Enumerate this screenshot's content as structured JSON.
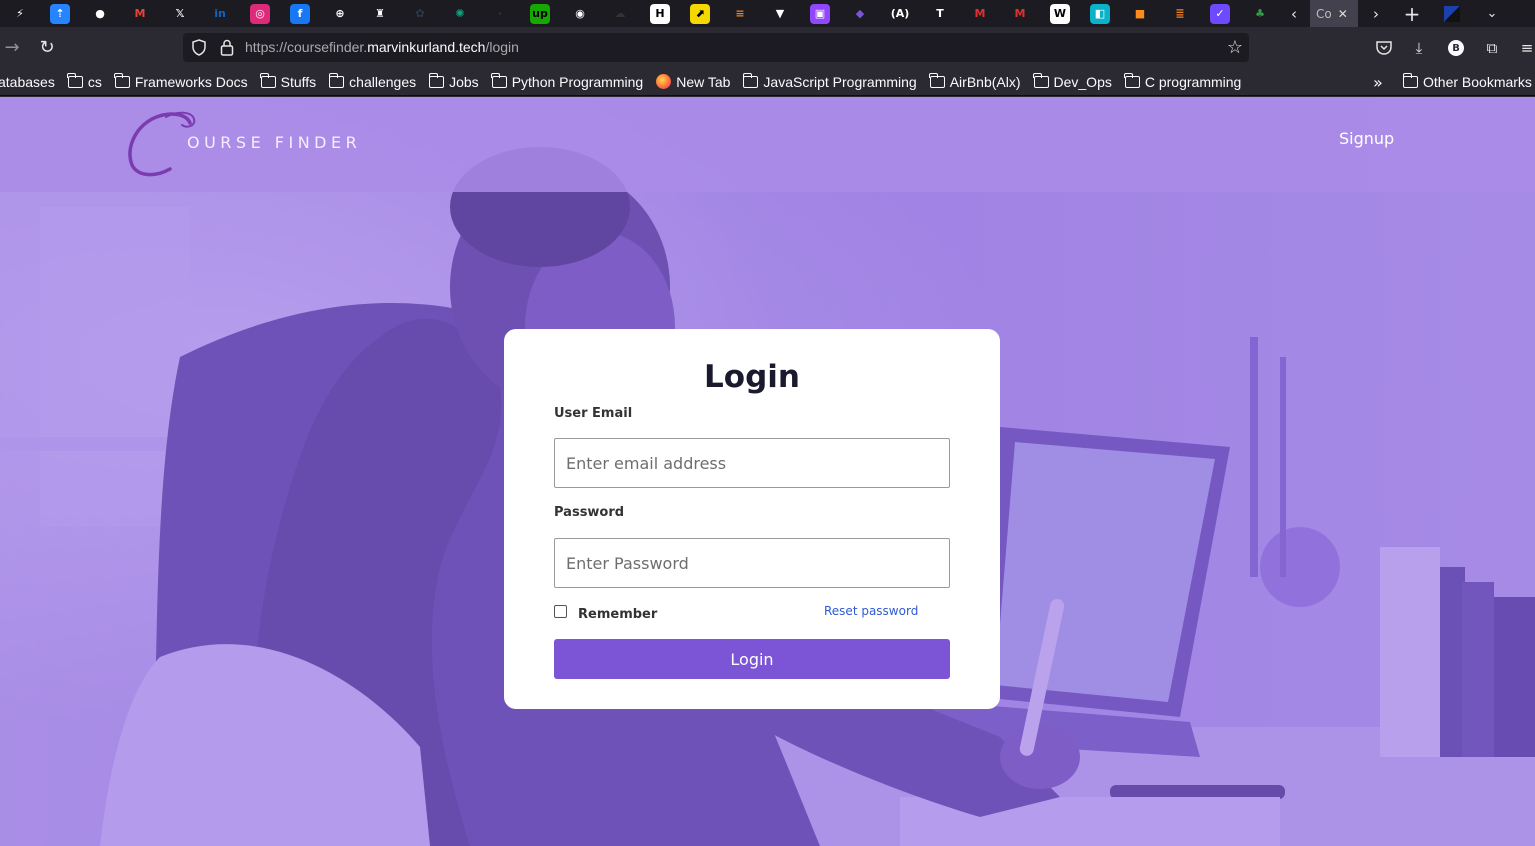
{
  "browser": {
    "tabs": [
      {
        "icon": "zed-icon",
        "glyph": "⚡",
        "color": "#ffffff",
        "bg": "#1c1b22"
      },
      {
        "icon": "jira-icon",
        "glyph": "⇡",
        "color": "#ffffff",
        "bg": "#2684ff"
      },
      {
        "icon": "reddit-icon",
        "glyph": "●",
        "color": "#ffffff",
        "bg": "#1c1b22"
      },
      {
        "icon": "gmail-icon",
        "glyph": "M",
        "color": "#ea4335",
        "bg": "#1c1b22"
      },
      {
        "icon": "x-icon",
        "glyph": "𝕏",
        "color": "#ffffff",
        "bg": "#1c1b22"
      },
      {
        "icon": "linkedin-icon",
        "glyph": "in",
        "color": "#0a66c2",
        "bg": "#1c1b22"
      },
      {
        "icon": "instagram-icon",
        "glyph": "◎",
        "color": "#ffffff",
        "bg": "#dd2a7b"
      },
      {
        "icon": "facebook-icon",
        "glyph": "f",
        "color": "#ffffff",
        "bg": "#1877f2"
      },
      {
        "icon": "globe-icon",
        "glyph": "⊕",
        "color": "#ffffff",
        "bg": "#1c1b22"
      },
      {
        "icon": "puzzle-icon",
        "glyph": "♜",
        "color": "#ffffff",
        "bg": "#1c1b22"
      },
      {
        "icon": "settings-icon",
        "glyph": "✿",
        "color": "#2a3a50",
        "bg": "#1c1b22"
      },
      {
        "icon": "chatgpt-icon",
        "glyph": "✺",
        "color": "#10a37f",
        "bg": "#1c1b22"
      },
      {
        "icon": "blank-icon",
        "glyph": "·",
        "color": "#333",
        "bg": "#1c1b22"
      },
      {
        "icon": "upwork-icon",
        "glyph": "up",
        "color": "#000000",
        "bg": "#14a800"
      },
      {
        "icon": "github-icon",
        "glyph": "◉",
        "color": "#ffffff",
        "bg": "#1c1b22"
      },
      {
        "icon": "cloud-icon",
        "glyph": "☁",
        "color": "#333",
        "bg": "#1c1b22"
      },
      {
        "icon": "hackernoon-icon",
        "glyph": "H",
        "color": "#000000",
        "bg": "#ffffff"
      },
      {
        "icon": "arrow-icon",
        "glyph": "⬈",
        "color": "#000000",
        "bg": "#f5d800"
      },
      {
        "icon": "stack-icon",
        "glyph": "≡",
        "color": "#f48024",
        "bg": "#1c1b22"
      },
      {
        "icon": "mic-icon",
        "glyph": "▼",
        "color": "#ffffff",
        "bg": "#1c1b22"
      },
      {
        "icon": "twitch-icon",
        "glyph": "▣",
        "color": "#ffffff",
        "bg": "#9146ff"
      },
      {
        "icon": "teams-icon",
        "glyph": "◆",
        "color": "#7b55d6",
        "bg": "#1c1b22"
      },
      {
        "icon": "alx-icon",
        "glyph": "(A)",
        "color": "#ffffff",
        "bg": "#1c1b22"
      },
      {
        "icon": "tool-icon",
        "glyph": "T",
        "color": "#ffffff",
        "bg": "#1c1b22"
      },
      {
        "icon": "medium-icon",
        "glyph": "M",
        "color": "#e03131",
        "bg": "#1c1b22"
      },
      {
        "icon": "medium-alt-icon",
        "glyph": "M",
        "color": "#e03131",
        "bg": "#1c1b22"
      },
      {
        "icon": "wiki-icon",
        "glyph": "W",
        "color": "#000000",
        "bg": "#ffffff"
      },
      {
        "icon": "doc-icon",
        "glyph": "◧",
        "color": "#ffffff",
        "bg": "#0ab3c9"
      },
      {
        "icon": "box-icon",
        "glyph": "■",
        "color": "#ff8c1a",
        "bg": "#1c1b22"
      },
      {
        "icon": "stackoverflow-icon",
        "glyph": "≣",
        "color": "#f48024",
        "bg": "#1c1b22"
      },
      {
        "icon": "proton-icon",
        "glyph": "✓",
        "color": "#ffffff",
        "bg": "#6d4aff"
      },
      {
        "icon": "tree-icon",
        "glyph": "♣",
        "color": "#2f9e44",
        "bg": "#1c1b22"
      }
    ],
    "active_tab_label": "Co",
    "url_prefix": "https://coursefinder.",
    "url_host": "marvinkurland.tech",
    "url_path": "/login",
    "bookmarks": [
      {
        "label": "atabases",
        "type": "plain"
      },
      {
        "label": "cs",
        "type": "folder"
      },
      {
        "label": "Frameworks Docs",
        "type": "folder"
      },
      {
        "label": "Stuffs",
        "type": "folder"
      },
      {
        "label": "challenges",
        "type": "folder"
      },
      {
        "label": "Jobs",
        "type": "folder"
      },
      {
        "label": "Python Programming",
        "type": "folder"
      },
      {
        "label": "New Tab",
        "type": "firefox"
      },
      {
        "label": "JavaScript Programming",
        "type": "folder"
      },
      {
        "label": "AirBnb(Alx)",
        "type": "folder"
      },
      {
        "label": "Dev_Ops",
        "type": "folder"
      },
      {
        "label": "C programming",
        "type": "folder"
      }
    ],
    "other_bookmarks": "Other Bookmarks",
    "profile_initial": "B"
  },
  "site": {
    "logo_letter": "C",
    "logo_text": "OURSE FINDER",
    "signup_label": "Signup",
    "overlay_color": "#8a62de"
  },
  "login": {
    "title": "Login",
    "email_label": "User Email",
    "email_placeholder": "Enter email address",
    "email_value": "",
    "password_label": "Password",
    "password_placeholder": "Enter Password",
    "password_value": "",
    "remember_label": "Remember",
    "remember_checked": false,
    "reset_label": "Reset password",
    "button_label": "Login",
    "button_color": "#7b55d6"
  }
}
